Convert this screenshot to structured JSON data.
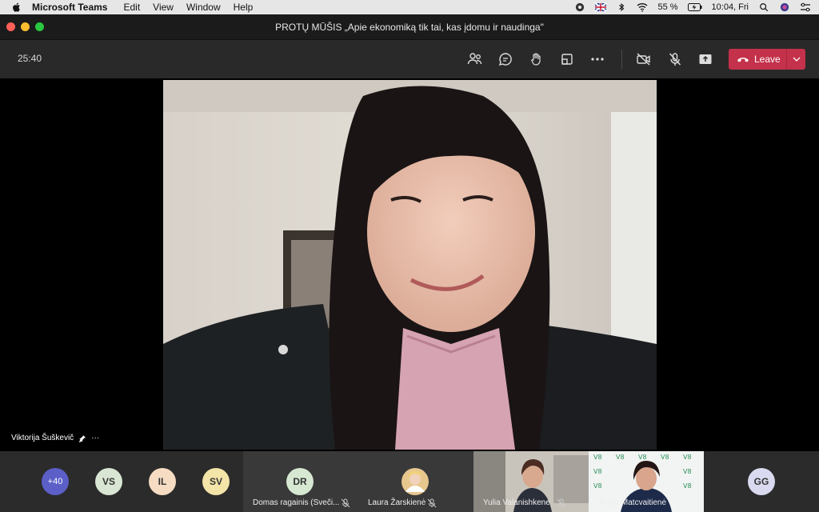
{
  "menubar": {
    "app_name": "Microsoft Teams",
    "menus": [
      "Edit",
      "View",
      "Window",
      "Help"
    ],
    "battery": "55 %",
    "clock": "10:04, Fri"
  },
  "window": {
    "title": "PROTŲ MŪŠIS „Apie ekonomiką tik tai, kas įdomu ir naudinga\""
  },
  "toolbar": {
    "timer": "25:40",
    "leave_label": "Leave"
  },
  "stage": {
    "pinned_name": "Viktorija Šuškevič",
    "more_glyph": "···"
  },
  "participants": {
    "overflow": "+40",
    "avatars": [
      {
        "initials": "VS",
        "color": "#d9e6d3"
      },
      {
        "initials": "IL",
        "color": "#f6dcc3"
      },
      {
        "initials": "SV",
        "color": "#f3e4a8"
      },
      {
        "initials": "DR",
        "color": "#d6e8d2"
      },
      {
        "initials": "GG",
        "color": "#d9d9ef"
      }
    ],
    "tile_names": [
      "Domas ragainis (Sveči...",
      "Laura Žarskienė",
      "Yulia Valanishkene",
      "Aušra Matcvaitienė"
    ]
  },
  "colors": {
    "leave": "#c4314b",
    "overflow": "#5b5fc7"
  }
}
